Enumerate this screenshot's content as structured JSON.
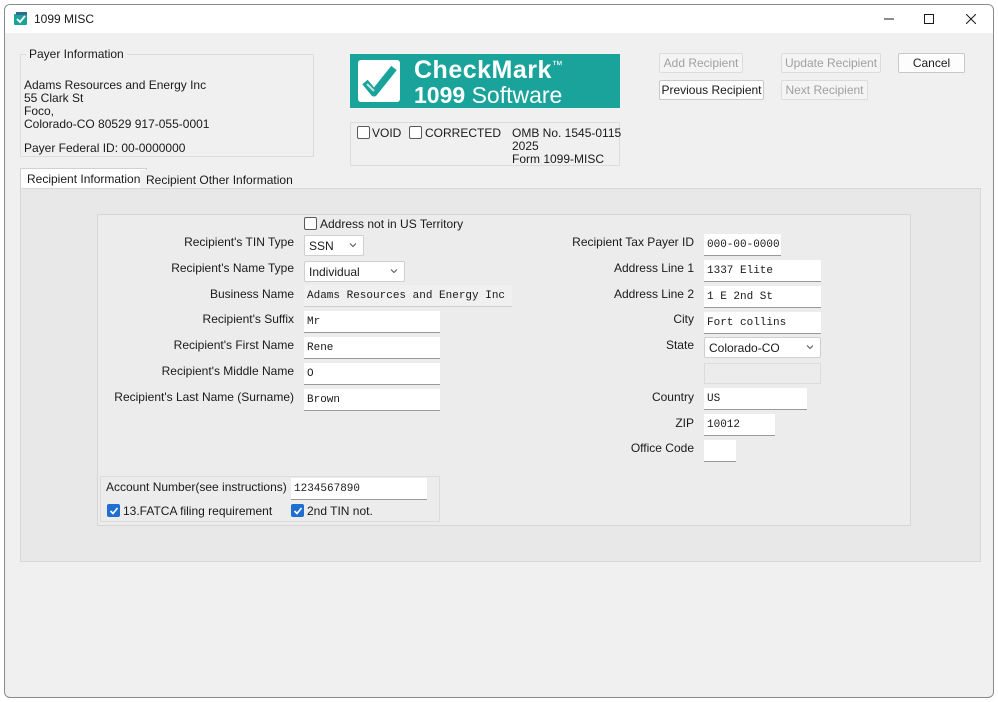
{
  "window": {
    "title": "1099 MISC"
  },
  "payer": {
    "legend": "Payer Information",
    "name": "Adams Resources and Energy Inc",
    "street": "55 Clark St",
    "city": "Foco,",
    "state_zip_phone": "Colorado-CO  80529  917-055-0001",
    "federal_id": "Payer Federal ID: 00-0000000"
  },
  "logo": {
    "line1": "CheckMark",
    "tm": "™",
    "line2_num": "1099",
    "line2_word": "Software",
    "colors": {
      "background": "#1aa39a",
      "check": "#1aa39a"
    }
  },
  "form_info": {
    "void_label": "VOID",
    "corrected_label": "CORRECTED",
    "omb": "OMB No. 1545-0115",
    "year": "2025",
    "form": "Form 1099-MISC"
  },
  "buttons": {
    "add_recipient": "Add Recipient",
    "update_recipient": "Update Recipient",
    "cancel": "Cancel",
    "previous_recipient": "Previous Recipient",
    "next_recipient": "Next Recipient"
  },
  "tabs": [
    {
      "label": "Recipient Information",
      "active": true
    },
    {
      "label": "Recipient Other Information",
      "active": false
    }
  ],
  "recipient": {
    "address_not_us_label": "Address not in US Territory",
    "tin_type_label": "Recipient's TIN Type",
    "tin_type_value": "SSN",
    "name_type_label": "Recipient's Name Type",
    "name_type_value": "Individual",
    "business_name_label": "Business Name",
    "business_name_value": "Adams Resources and Energy Inc",
    "suffix_label": "Recipient's Suffix",
    "suffix_value": "Mr",
    "first_name_label": "Recipient's First Name",
    "first_name_value": "Rene",
    "middle_name_label": "Recipient's Middle Name",
    "middle_name_value": "O",
    "last_name_label": "Recipient's Last Name (Surname)",
    "last_name_value": "Brown",
    "tax_payer_id_label": "Recipient Tax Payer ID",
    "tax_payer_id_value": "000-00-0000",
    "address1_label": "Address Line 1",
    "address1_value": "1337 Elite",
    "address2_label": "Address Line 2",
    "address2_value": "1 E 2nd St",
    "city_label": "City",
    "city_value": "Fort collins",
    "state_label": "State",
    "state_value": "Colorado-CO",
    "country_label": "Country",
    "country_value": "US",
    "zip_label": "ZIP",
    "zip_value": "10012",
    "office_code_label": "Office Code",
    "office_code_value": ""
  },
  "account": {
    "label": "Account Number(see instructions)",
    "value": "1234567890",
    "fatca_label": "13.FATCA filing requirement",
    "fatca_checked": true,
    "second_tin_label": "2nd TIN not.",
    "second_tin_checked": true
  }
}
